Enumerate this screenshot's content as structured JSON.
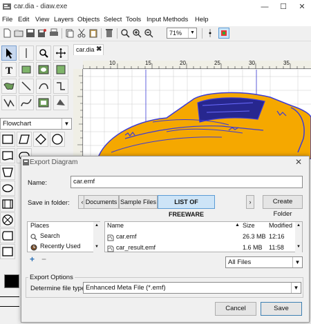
{
  "window": {
    "title": "car.dia - diaw.exe",
    "minimize": "—",
    "maximize": "☐",
    "close": "✕"
  },
  "menu": [
    "File",
    "Edit",
    "View",
    "Layers",
    "Objects",
    "Select",
    "Tools",
    "Input Methods",
    "Help"
  ],
  "toolbar": {
    "zoom_value": "71%"
  },
  "sheet": {
    "selected": "Flowchart"
  },
  "diagram_tab": {
    "name": "car.dia",
    "close": "✖"
  },
  "ruler": {
    "ticks": [
      "10",
      "15",
      "20",
      "25",
      "30",
      "35"
    ]
  },
  "colors": {
    "accent": "#5b9bd5",
    "car_body": "#f5a800",
    "car_outline": "#3b3bd8"
  },
  "dialog": {
    "title": "Export Diagram",
    "close": "✕",
    "name_label": "Name:",
    "name_value": "car.emf",
    "save_in_label": "Save in folder:",
    "path": [
      "Documents",
      "Sample Files",
      "LIST OF FREEWARE"
    ],
    "create_folder": "Create Folder",
    "places_header": "Places",
    "places": [
      "Search",
      "Recently Used"
    ],
    "columns": {
      "name": "Name",
      "size": "Size",
      "modified": "Modified"
    },
    "files": [
      {
        "name": "car.emf",
        "size": "26.3 MB",
        "modified": "12:16"
      },
      {
        "name": "car_result.emf",
        "size": "1.6 MB",
        "modified": "11:58"
      }
    ],
    "filter": "All Files",
    "add": "+",
    "remove": "−",
    "export_options": "Export Options",
    "file_type_label": "Determine file type:",
    "file_type_value": "Enhanced Meta File (*.emf)",
    "cancel": "Cancel",
    "save": "Save"
  }
}
